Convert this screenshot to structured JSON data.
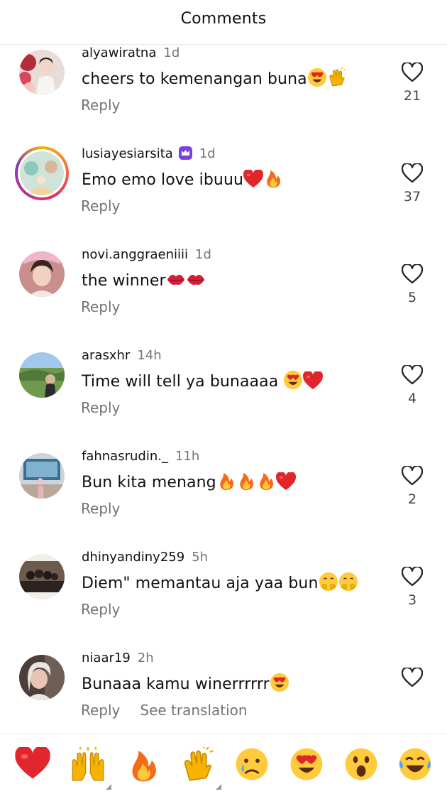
{
  "header": {
    "title": "Comments"
  },
  "comments": [
    {
      "username": "alyawiratna",
      "time": "1d",
      "text": "cheers to kemenangan buna",
      "reply": "Reply",
      "likes": "21",
      "verified": false
    },
    {
      "username": "lusiayesiarsita",
      "time": "1d",
      "text": "Emo emo love ibuuu",
      "reply": "Reply",
      "likes": "37",
      "verified": true
    },
    {
      "username": "novi.anggraeniiii",
      "time": "1d",
      "text": "the winner",
      "reply": "Reply",
      "likes": "5",
      "verified": false
    },
    {
      "username": "arasxhr",
      "time": "14h",
      "text": "Time will tell ya bunaaaa ",
      "reply": "Reply",
      "likes": "4",
      "verified": false
    },
    {
      "username": "fahnasrudin._",
      "time": "11h",
      "text": "Bun kita menang",
      "reply": "Reply",
      "likes": "2",
      "verified": false
    },
    {
      "username": "dhinyandiny259",
      "time": "5h",
      "text": "Diem\" memantau aja yaa bun",
      "reply": "Reply",
      "likes": "3",
      "verified": false
    },
    {
      "username": "niaar19",
      "time": "2h",
      "text": "Bunaaa kamu winerrrrrr",
      "reply": "Reply",
      "see_translation": "See translation",
      "likes": "",
      "verified": false
    }
  ],
  "reactions": [
    "red-heart-icon",
    "raising-hands-icon",
    "fire-icon",
    "clapping-hands-icon",
    "crying-face-icon",
    "heart-eyes-icon",
    "surprised-face-icon",
    "laughing-tears-icon"
  ],
  "colors": {
    "muted": "#737373",
    "red": "#e0262b",
    "verified": "#7b3fe4"
  }
}
